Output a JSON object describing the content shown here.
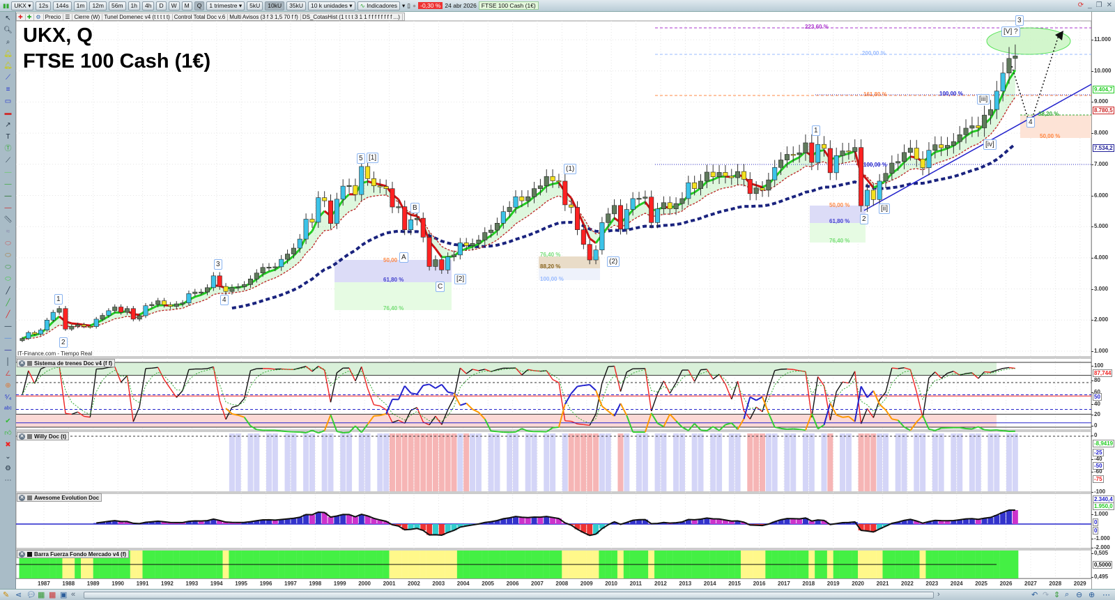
{
  "toolbar": {
    "symbol": "UKX",
    "timeframes": [
      "12s",
      "144s",
      "1m",
      "12m",
      "56m",
      "1h",
      "4h",
      "D",
      "W",
      "M",
      "Q"
    ],
    "period": "1 trimestre",
    "units": [
      "5kU",
      "10kU",
      "35kU"
    ],
    "unit_select": "10 k unidades",
    "indicators": "Indicadores",
    "change": "-0,30 %",
    "date": "24 abr 2026",
    "instrument": "FTSE 100 Cash (1€)"
  },
  "chips": [
    "Precio",
    "Cierre (W)",
    "Tunel Domenec v4 (t t t t t)",
    "Control Total Doc v.6",
    "Multi Avisos (3 f 3 1,5 70 f f)",
    "DS_CotasHist (1 t t t 3 1 1 f f f f f f f f ...)"
  ],
  "main": {
    "title1": "UKX, Q",
    "title2": "FTSE 100 Cash (1€)",
    "source": "IT-Finance.com - Tiempo Real",
    "price_ticks": [
      "11.000",
      "10.000",
      "9.000",
      "8.000",
      "7.000",
      "6.000",
      "5.000",
      "4.000",
      "3.000",
      "2.000",
      "1.000"
    ],
    "tags": {
      "green": "9.404,7",
      "red": "8.780,5",
      "blue": "7.534,2"
    },
    "wave_labels": [
      "1",
      "2",
      "3",
      "4",
      "5",
      "[1]",
      "A",
      "B",
      "C",
      "[2]",
      "(1)",
      "(2)",
      "1",
      "2",
      "[ii]",
      "[iii]",
      "[iv]",
      "4",
      "3",
      "[V] ?"
    ],
    "fib_labels": [
      "223,60 %",
      "200,00 %",
      "161,80 %",
      "100,00 %",
      "38,20 %",
      "50,00 %",
      "100,00 %",
      "50,00 %",
      "61,80 %",
      "76,40 %",
      "50,00",
      "61,80 %",
      "76,40 %",
      "76,40 %",
      "88,20 %",
      "100,00 %"
    ]
  },
  "panels": {
    "trenes": {
      "title": "Sistema de trenes Doc v4 (f f)",
      "ticks": [
        "100",
        "80",
        "60",
        "40",
        "20",
        "0"
      ],
      "tag_red": "87,744",
      "tag_blue": "50"
    },
    "willy": {
      "title": "Willy Doc (t)",
      "ticks": [
        "0",
        "-40",
        "-60",
        "-100"
      ],
      "tag_green": "-8,9419",
      "tag_blue1": "-25",
      "tag_blue2": "-50",
      "tag_red": "-75"
    },
    "awesome": {
      "title": "Awesome Evolution Doc",
      "ticks": [
        "1.000",
        "-1.000",
        "-2.000"
      ],
      "tag_blue": "2.340,4",
      "tag_green": "1.950,0",
      "tag_zero1": "0",
      "tag_zero2": "0"
    },
    "barra": {
      "title": "Barra Fuerza Fondo Mercado v4 (f)",
      "ticks": [
        "0,505",
        "0,495"
      ],
      "tag": "0,5000"
    }
  },
  "xaxis": [
    "1987",
    "1988",
    "1989",
    "1990",
    "1991",
    "1992",
    "1993",
    "1994",
    "1995",
    "1996",
    "1997",
    "1998",
    "1999",
    "2000",
    "2001",
    "2002",
    "2003",
    "2004",
    "2005",
    "2006",
    "2007",
    "2008",
    "2009",
    "2010",
    "2011",
    "2012",
    "2013",
    "2014",
    "2015",
    "2016",
    "2017",
    "2018",
    "2019",
    "2020",
    "2021",
    "2022",
    "2023",
    "2024",
    "2025",
    "2026",
    "2027",
    "2028",
    "2029"
  ],
  "chart_data": {
    "type": "candlestick",
    "title": "UKX, Q - FTSE 100 Cash (1€)",
    "start": "1986Q1",
    "frequency": "quarterly",
    "ylim": [
      1000,
      11000
    ],
    "closes": [
      1410,
      1600,
      1550,
      1680,
      2000,
      2250,
      2370,
      1710,
      1800,
      1850,
      1800,
      1790,
      2030,
      2150,
      2300,
      2420,
      2250,
      2370,
      2030,
      2140,
      2460,
      2500,
      2620,
      2490,
      2440,
      2520,
      2550,
      2850,
      2900,
      2900,
      3040,
      3420,
      3080,
      2920,
      3040,
      3070,
      3140,
      3320,
      3510,
      3690,
      3700,
      3710,
      3950,
      4120,
      4310,
      4600,
      5240,
      5140,
      5930,
      5830,
      5100,
      5880,
      6300,
      6320,
      6030,
      6930,
      6540,
      6310,
      6290,
      6220,
      5630,
      5640,
      4900,
      5220,
      5270,
      4660,
      3720,
      3940,
      3610,
      4030,
      4090,
      4480,
      4390,
      4460,
      4570,
      4810,
      4890,
      5110,
      5480,
      5620,
      5960,
      5830,
      5960,
      6220,
      6310,
      6610,
      6470,
      6460,
      5700,
      5620,
      4900,
      4430,
      3930,
      4250,
      5130,
      5410,
      5680,
      4920,
      5550,
      5900,
      5910,
      5950,
      5130,
      5570,
      5770,
      5570,
      5740,
      5900,
      6410,
      6220,
      6460,
      6750,
      6600,
      6740,
      6620,
      6570,
      6770,
      6520,
      6060,
      6240,
      6170,
      6500,
      6900,
      7140,
      7320,
      7310,
      7370,
      7690,
      7060,
      7640,
      7510,
      6730,
      7280,
      7430,
      7410,
      7540,
      5670,
      6170,
      5870,
      6460,
      6710,
      7040,
      7090,
      7380,
      7520,
      7170,
      6890,
      7450,
      7630,
      7530,
      7610,
      7730,
      7950,
      8160,
      8240,
      8170,
      8580,
      8760,
      9350,
      9930,
      10400,
      10480
    ]
  }
}
